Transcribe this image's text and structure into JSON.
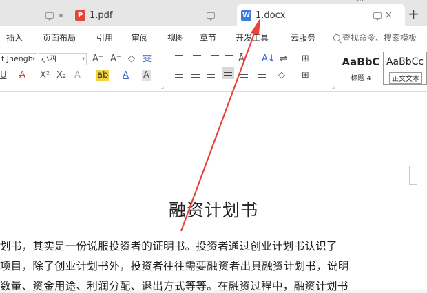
{
  "tabs": [
    {
      "label": "1.pdf",
      "icon": "pdf-icon",
      "icon_text": "P"
    },
    {
      "label": "1.docx",
      "icon": "word-icon",
      "icon_text": "W"
    }
  ],
  "top_right_text": "…",
  "new_tab_symbol": "+",
  "close_symbol": "×",
  "menu": [
    "插入",
    "页面布局",
    "引用",
    "审阅",
    "视图",
    "章节",
    "开发工具",
    "云服务"
  ],
  "search_placeholder": "查找命令、搜索模板",
  "ribbon": {
    "font_name": "t Jhengh",
    "font_size": "小四",
    "grow_font": "A⁺",
    "shrink_font": "A⁻",
    "clear_format": "◇",
    "phonetic": "雯",
    "underline": "U",
    "strike": "A",
    "superscript": "X²",
    "subscript": "X₂",
    "text_effect": "A",
    "highlight": "ab",
    "font_color": "A",
    "char_shading": "A",
    "sort": "A↓",
    "styles": [
      {
        "preview": "AaBbC",
        "name": "标题 4"
      },
      {
        "preview": "AaBbCc",
        "name": "正文文本"
      }
    ]
  },
  "document": {
    "title": "融资计划书",
    "lines": [
      "划书，其实是一份说服投资者的证明书。投资者通过创业计划书认识了",
      "项目，除了创业计划书外，投资者往往需要融资者出具融资计划书，说明",
      "数量、资金用途、利润分配、退出方式等等。在融资过程中，融资计划书"
    ],
    "caret_after": "项目，除了创业计划书外，投资者往往需要融"
  },
  "colors": {
    "accent": "#3c7bdc",
    "pdf_red": "#e2463e",
    "arrow": "#e8423a"
  }
}
